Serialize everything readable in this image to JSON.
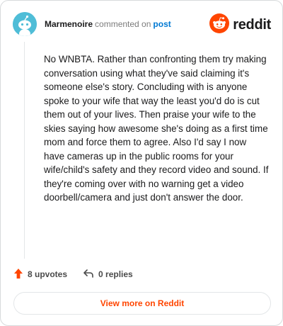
{
  "header": {
    "author": "Marmenoire",
    "action": "commented on",
    "post_link": "post",
    "brand": "reddit",
    "avatar_icon": "snoo-avatar-icon",
    "brand_icon": "reddit-logo-icon"
  },
  "comment": {
    "body": "No WNBTA. Rather than confronting them try making conversation using what they've said claiming it's someone else's story. Concluding with is anyone spoke to your wife that way the least you'd do is cut them out of your lives. Then praise your wife to the skies saying how awesome she's doing as a first time mom and force them to agree. Also I'd say I now have cameras up in the public rooms for your wife/child's safety and they record video and sound. If they're coming over with no warning get a video doorbell/camera and just don't answer the door."
  },
  "actions": {
    "upvotes": "8 upvotes",
    "replies": "0 replies",
    "upvote_icon": "upvote-arrow-icon",
    "reply_icon": "reply-arrow-icon"
  },
  "footer": {
    "view_more": "View more on Reddit"
  },
  "colors": {
    "brand_orange": "#ff4500",
    "link_blue": "#0079d3",
    "avatar_blue": "#4fbdd7",
    "border": "#d7dadc"
  }
}
